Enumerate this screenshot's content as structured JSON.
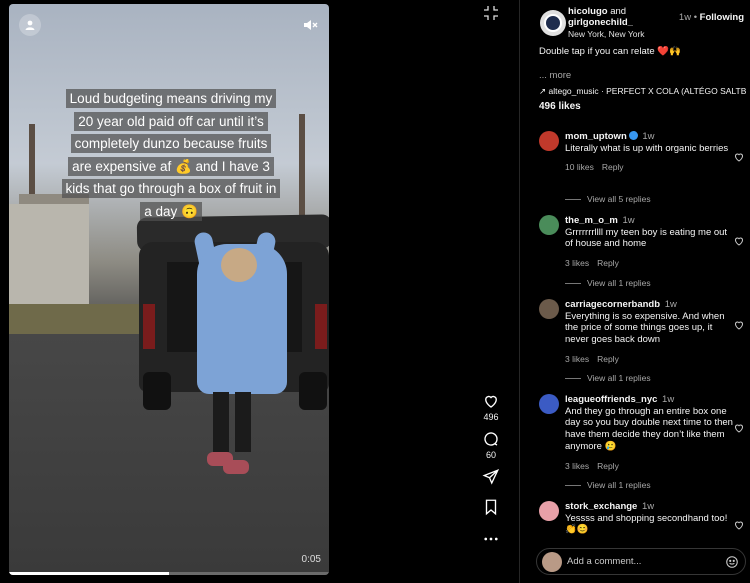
{
  "video": {
    "caption": "Loud budgeting means driving my 20 year old paid off car until it’s completely dunzo because fruits are expensive af 💰 and I have 3 kids that go through a box of fruit in a day 🙃",
    "timer": "0:05",
    "progress_fraction": 0.5,
    "icons": {
      "avatar": "person-icon",
      "mute": "speaker-muted-icon",
      "expand": "collapse-arrows-icon"
    }
  },
  "actions": {
    "like_count": "496",
    "comment_count": "60",
    "icons": [
      "heart-icon",
      "comment-bubble-icon",
      "share-paper-plane-icon",
      "bookmark-icon",
      "more-dots-icon"
    ]
  },
  "post": {
    "author1": "hicolugo",
    "joiner": "and",
    "author2": "girlgonechild_",
    "location": "New York, New York",
    "age": "1w",
    "follow_label": "Following",
    "caption": "Double tap if you can relate ❤️🙌",
    "more": "... more",
    "music": "altego_music · PERFECT X COLA (ALTÉGO SALTB...",
    "likes": "496 likes"
  },
  "comments": [
    {
      "user": "mom_uptown",
      "verified": true,
      "time": "1w",
      "text": "Literally what is up with organic berries",
      "likes": "10 likes",
      "reply": "Reply",
      "replies": "View all 5 replies",
      "avatar_color": "#c0392b"
    },
    {
      "user": "the_m_o_m",
      "verified": false,
      "time": "1w",
      "text": "Grrrrrrrllll my teen boy is eating me out of house and home",
      "likes": "3 likes",
      "reply": "Reply",
      "replies": "View all 1 replies",
      "avatar_color": "#4a8c5a"
    },
    {
      "user": "carriagecornerbandb",
      "verified": false,
      "time": "1w",
      "text": "Everything is so expensive. And when the price of some things goes up, it never goes back down",
      "likes": "3 likes",
      "reply": "Reply",
      "replies": "View all 1 replies",
      "avatar_color": "#6b5a4a"
    },
    {
      "user": "leagueoffriends_nyc",
      "verified": false,
      "time": "1w",
      "text": "And they go through an entire box one day so you buy double next time to then have them decide they don’t like them anymore 🥲",
      "likes": "3 likes",
      "reply": "Reply",
      "replies": "View all 1 replies",
      "avatar_color": "#3b5bc4"
    },
    {
      "user": "stork_exchange",
      "verified": false,
      "time": "1w",
      "text": "Yessss and shopping secondhand too! 👏😊",
      "avatar_color": "#e8a0a8"
    }
  ],
  "comment_input": {
    "placeholder": "Add a comment..."
  }
}
